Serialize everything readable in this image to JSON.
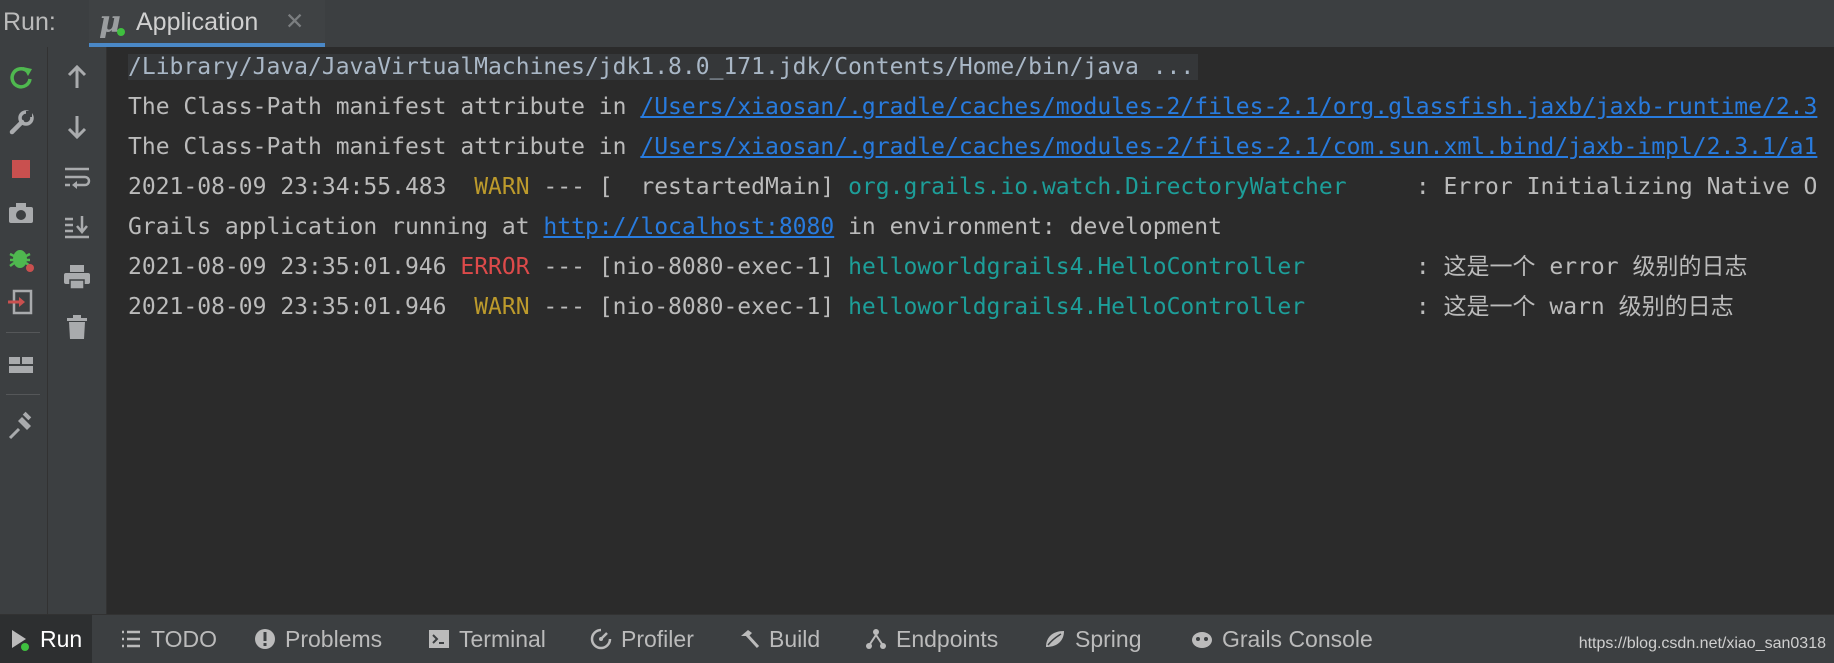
{
  "header": {
    "run_label": "Run:",
    "tab": {
      "label": "Application",
      "icon": "grails-mu-icon",
      "close": "✕"
    }
  },
  "toolbar_left": [
    "rerun-icon",
    "wrench-icon",
    "stop-icon",
    "camera-icon",
    "debug-bug-icon",
    "exit-icon",
    "layout-icon",
    "pin-icon"
  ],
  "toolbar_right": [
    "arrow-up-icon",
    "arrow-down-icon",
    "soft-wrap-icon",
    "scroll-to-end-icon",
    "print-icon",
    "trash-icon"
  ],
  "console": {
    "cmd": "/Library/Java/JavaVirtualMachines/jdk1.8.0_171.jdk/Contents/Home/bin/java ...",
    "line1": {
      "prefix": "The Class-Path manifest attribute in ",
      "path": "/Users/xiaosan/.gradle/caches/modules-2/files-2.1/org.glassfish.jaxb/jaxb-runtime/2.3"
    },
    "line2": {
      "prefix": "The Class-Path manifest attribute in ",
      "path": "/Users/xiaosan/.gradle/caches/modules-2/files-2.1/com.sun.xml.bind/jaxb-impl/2.3.1/a1"
    },
    "line3": {
      "ts": "2021-08-09 23:34:55.483  ",
      "level": "WARN",
      "mid": " --- [  restartedMain] ",
      "logger": "org.grails.io.watch.DirectoryWatcher",
      "msg": "     : Error Initializing Native O"
    },
    "line4": {
      "prefix": "Grails application running at ",
      "url": "http://localhost:8080",
      "suffix": " in environment: development"
    },
    "line5": {
      "ts": "2021-08-09 23:35:01.946 ",
      "level": "ERROR",
      "mid": " --- [nio-8080-exec-1] ",
      "logger": "helloworldgrails4.HelloController",
      "msg": "        : 这是一个 error 级别的日志"
    },
    "line6": {
      "ts": "2021-08-09 23:35:01.946  ",
      "level": "WARN",
      "mid": " --- [nio-8080-exec-1] ",
      "logger": "helloworldgrails4.HelloController",
      "msg": "        : 这是一个 warn 级别的日志"
    }
  },
  "bottom_tabs": {
    "run": "Run",
    "todo": "TODO",
    "problems": "Problems",
    "terminal": "Terminal",
    "profiler": "Profiler",
    "build": "Build",
    "endpoints": "Endpoints",
    "spring": "Spring",
    "grails_console": "Grails Console"
  },
  "watermark": "https://blog.csdn.net/xiao_san0318",
  "colors": {
    "background": "#2b2b2b",
    "panel": "#3c3f41",
    "link": "#287bde",
    "warn": "#bc9a2c",
    "error": "#dd4a4a",
    "logger": "#1d9e99",
    "tab_underline": "#4a88c7"
  }
}
